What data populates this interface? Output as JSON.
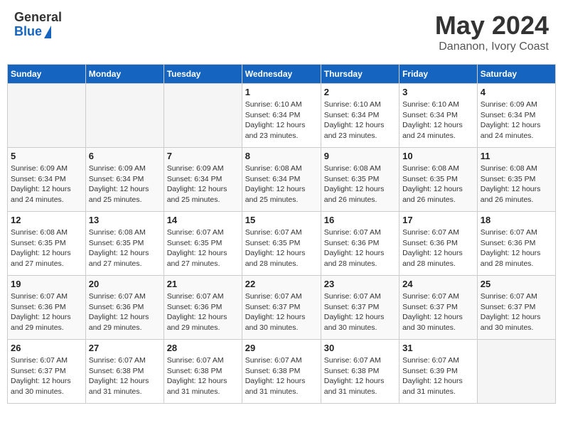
{
  "header": {
    "logo_line1": "General",
    "logo_line2": "Blue",
    "month": "May 2024",
    "location": "Dananon, Ivory Coast"
  },
  "days_of_week": [
    "Sunday",
    "Monday",
    "Tuesday",
    "Wednesday",
    "Thursday",
    "Friday",
    "Saturday"
  ],
  "weeks": [
    [
      {
        "day": "",
        "sunrise": "",
        "sunset": "",
        "daylight": ""
      },
      {
        "day": "",
        "sunrise": "",
        "sunset": "",
        "daylight": ""
      },
      {
        "day": "",
        "sunrise": "",
        "sunset": "",
        "daylight": ""
      },
      {
        "day": "1",
        "sunrise": "Sunrise: 6:10 AM",
        "sunset": "Sunset: 6:34 PM",
        "daylight": "Daylight: 12 hours and 23 minutes."
      },
      {
        "day": "2",
        "sunrise": "Sunrise: 6:10 AM",
        "sunset": "Sunset: 6:34 PM",
        "daylight": "Daylight: 12 hours and 23 minutes."
      },
      {
        "day": "3",
        "sunrise": "Sunrise: 6:10 AM",
        "sunset": "Sunset: 6:34 PM",
        "daylight": "Daylight: 12 hours and 24 minutes."
      },
      {
        "day": "4",
        "sunrise": "Sunrise: 6:09 AM",
        "sunset": "Sunset: 6:34 PM",
        "daylight": "Daylight: 12 hours and 24 minutes."
      }
    ],
    [
      {
        "day": "5",
        "sunrise": "Sunrise: 6:09 AM",
        "sunset": "Sunset: 6:34 PM",
        "daylight": "Daylight: 12 hours and 24 minutes."
      },
      {
        "day": "6",
        "sunrise": "Sunrise: 6:09 AM",
        "sunset": "Sunset: 6:34 PM",
        "daylight": "Daylight: 12 hours and 25 minutes."
      },
      {
        "day": "7",
        "sunrise": "Sunrise: 6:09 AM",
        "sunset": "Sunset: 6:34 PM",
        "daylight": "Daylight: 12 hours and 25 minutes."
      },
      {
        "day": "8",
        "sunrise": "Sunrise: 6:08 AM",
        "sunset": "Sunset: 6:34 PM",
        "daylight": "Daylight: 12 hours and 25 minutes."
      },
      {
        "day": "9",
        "sunrise": "Sunrise: 6:08 AM",
        "sunset": "Sunset: 6:35 PM",
        "daylight": "Daylight: 12 hours and 26 minutes."
      },
      {
        "day": "10",
        "sunrise": "Sunrise: 6:08 AM",
        "sunset": "Sunset: 6:35 PM",
        "daylight": "Daylight: 12 hours and 26 minutes."
      },
      {
        "day": "11",
        "sunrise": "Sunrise: 6:08 AM",
        "sunset": "Sunset: 6:35 PM",
        "daylight": "Daylight: 12 hours and 26 minutes."
      }
    ],
    [
      {
        "day": "12",
        "sunrise": "Sunrise: 6:08 AM",
        "sunset": "Sunset: 6:35 PM",
        "daylight": "Daylight: 12 hours and 27 minutes."
      },
      {
        "day": "13",
        "sunrise": "Sunrise: 6:08 AM",
        "sunset": "Sunset: 6:35 PM",
        "daylight": "Daylight: 12 hours and 27 minutes."
      },
      {
        "day": "14",
        "sunrise": "Sunrise: 6:07 AM",
        "sunset": "Sunset: 6:35 PM",
        "daylight": "Daylight: 12 hours and 27 minutes."
      },
      {
        "day": "15",
        "sunrise": "Sunrise: 6:07 AM",
        "sunset": "Sunset: 6:35 PM",
        "daylight": "Daylight: 12 hours and 28 minutes."
      },
      {
        "day": "16",
        "sunrise": "Sunrise: 6:07 AM",
        "sunset": "Sunset: 6:36 PM",
        "daylight": "Daylight: 12 hours and 28 minutes."
      },
      {
        "day": "17",
        "sunrise": "Sunrise: 6:07 AM",
        "sunset": "Sunset: 6:36 PM",
        "daylight": "Daylight: 12 hours and 28 minutes."
      },
      {
        "day": "18",
        "sunrise": "Sunrise: 6:07 AM",
        "sunset": "Sunset: 6:36 PM",
        "daylight": "Daylight: 12 hours and 28 minutes."
      }
    ],
    [
      {
        "day": "19",
        "sunrise": "Sunrise: 6:07 AM",
        "sunset": "Sunset: 6:36 PM",
        "daylight": "Daylight: 12 hours and 29 minutes."
      },
      {
        "day": "20",
        "sunrise": "Sunrise: 6:07 AM",
        "sunset": "Sunset: 6:36 PM",
        "daylight": "Daylight: 12 hours and 29 minutes."
      },
      {
        "day": "21",
        "sunrise": "Sunrise: 6:07 AM",
        "sunset": "Sunset: 6:36 PM",
        "daylight": "Daylight: 12 hours and 29 minutes."
      },
      {
        "day": "22",
        "sunrise": "Sunrise: 6:07 AM",
        "sunset": "Sunset: 6:37 PM",
        "daylight": "Daylight: 12 hours and 30 minutes."
      },
      {
        "day": "23",
        "sunrise": "Sunrise: 6:07 AM",
        "sunset": "Sunset: 6:37 PM",
        "daylight": "Daylight: 12 hours and 30 minutes."
      },
      {
        "day": "24",
        "sunrise": "Sunrise: 6:07 AM",
        "sunset": "Sunset: 6:37 PM",
        "daylight": "Daylight: 12 hours and 30 minutes."
      },
      {
        "day": "25",
        "sunrise": "Sunrise: 6:07 AM",
        "sunset": "Sunset: 6:37 PM",
        "daylight": "Daylight: 12 hours and 30 minutes."
      }
    ],
    [
      {
        "day": "26",
        "sunrise": "Sunrise: 6:07 AM",
        "sunset": "Sunset: 6:37 PM",
        "daylight": "Daylight: 12 hours and 30 minutes."
      },
      {
        "day": "27",
        "sunrise": "Sunrise: 6:07 AM",
        "sunset": "Sunset: 6:38 PM",
        "daylight": "Daylight: 12 hours and 31 minutes."
      },
      {
        "day": "28",
        "sunrise": "Sunrise: 6:07 AM",
        "sunset": "Sunset: 6:38 PM",
        "daylight": "Daylight: 12 hours and 31 minutes."
      },
      {
        "day": "29",
        "sunrise": "Sunrise: 6:07 AM",
        "sunset": "Sunset: 6:38 PM",
        "daylight": "Daylight: 12 hours and 31 minutes."
      },
      {
        "day": "30",
        "sunrise": "Sunrise: 6:07 AM",
        "sunset": "Sunset: 6:38 PM",
        "daylight": "Daylight: 12 hours and 31 minutes."
      },
      {
        "day": "31",
        "sunrise": "Sunrise: 6:07 AM",
        "sunset": "Sunset: 6:39 PM",
        "daylight": "Daylight: 12 hours and 31 minutes."
      },
      {
        "day": "",
        "sunrise": "",
        "sunset": "",
        "daylight": ""
      }
    ]
  ]
}
